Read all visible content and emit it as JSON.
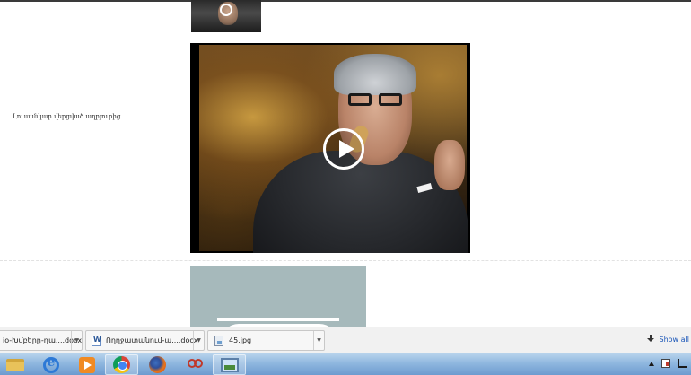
{
  "page": {
    "caption": "Լուսանկար վերցված աղբյուրից"
  },
  "downloads": {
    "items": [
      {
        "name": "io-Խմբերը-դա....docx",
        "type": "word"
      },
      {
        "name": "Ողղջատանում-ա....docx",
        "type": "word"
      },
      {
        "name": "45.jpg",
        "type": "image"
      }
    ],
    "show_all": "Show all"
  },
  "taskbar": {
    "apps": [
      "file-explorer",
      "internet-explorer",
      "media-player",
      "chrome",
      "firefox",
      "snipping-tool",
      "photo-viewer"
    ]
  }
}
